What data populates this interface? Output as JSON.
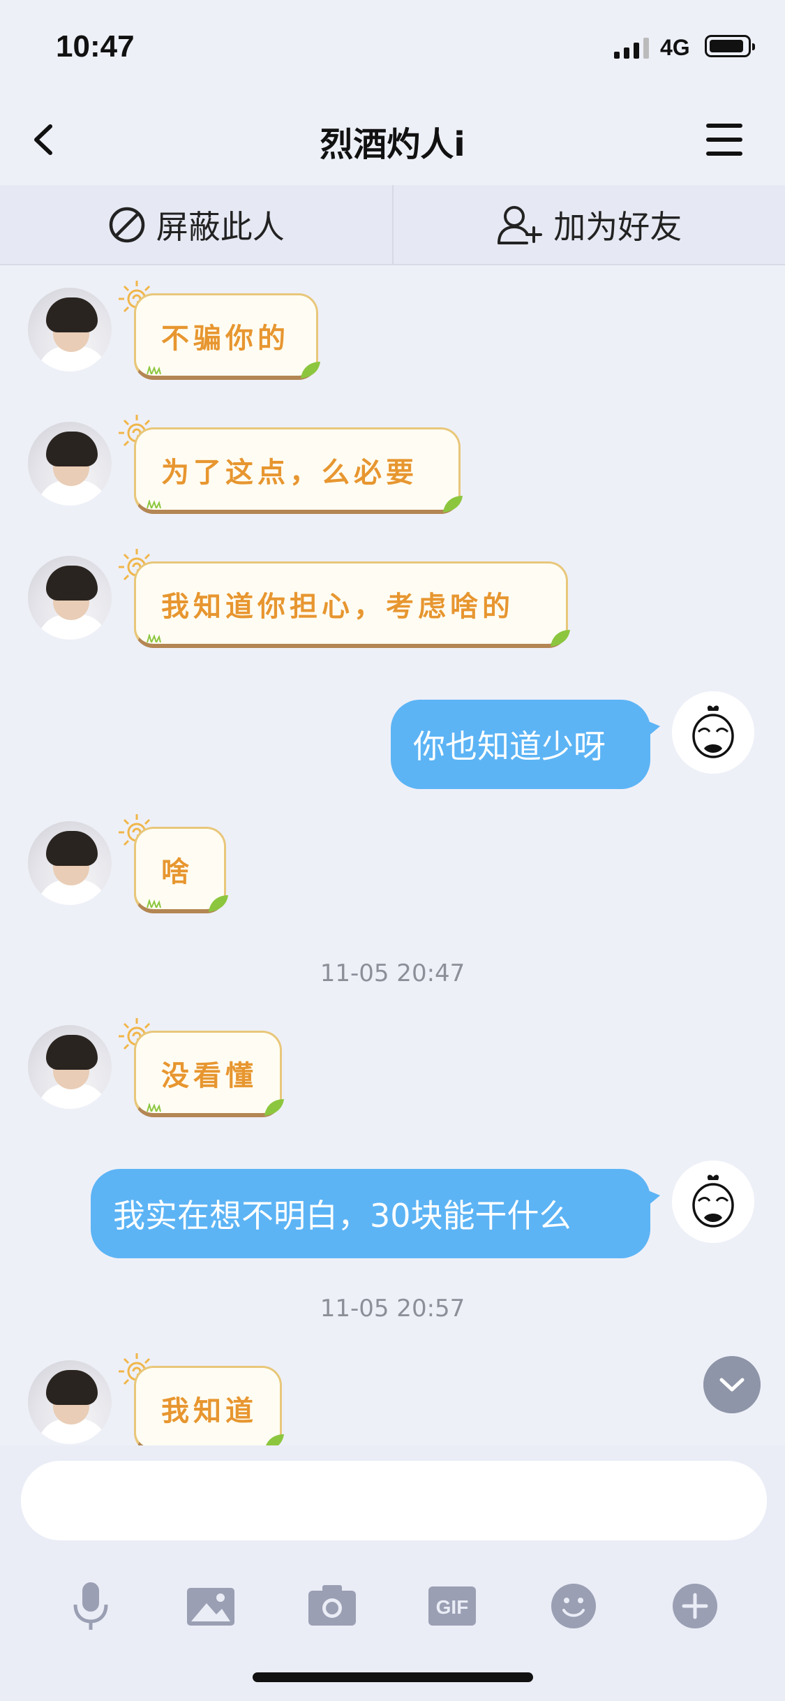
{
  "status_bar": {
    "time": "10:47",
    "network": "4G"
  },
  "header": {
    "title": "烈酒灼人i"
  },
  "actions": {
    "block_label": "屏蔽此人",
    "add_friend_label": "加为好友"
  },
  "messages": [
    {
      "from": "them",
      "text": "不骗你的"
    },
    {
      "from": "them",
      "text": "为了这点，么必要"
    },
    {
      "from": "them",
      "text": "我知道你担心，考虑啥的"
    },
    {
      "from": "me",
      "text": "你也知道少呀"
    },
    {
      "from": "them",
      "text": "啥"
    },
    {
      "timestamp": "11-05 20:47"
    },
    {
      "from": "them",
      "text": "没看懂"
    },
    {
      "from": "me",
      "text": "我实在想不明白，30块能干什么"
    },
    {
      "timestamp": "11-05 20:57"
    },
    {
      "from": "them",
      "text": "我知道"
    }
  ],
  "input": {
    "placeholder": ""
  },
  "toolbar": [
    "mic-icon",
    "image-icon",
    "camera-icon",
    "gif-icon",
    "emoji-icon",
    "plus-icon"
  ],
  "colors": {
    "bubble_me": "#5cb4f5",
    "sticker_text": "#e79630",
    "background": "#eef0f8"
  }
}
